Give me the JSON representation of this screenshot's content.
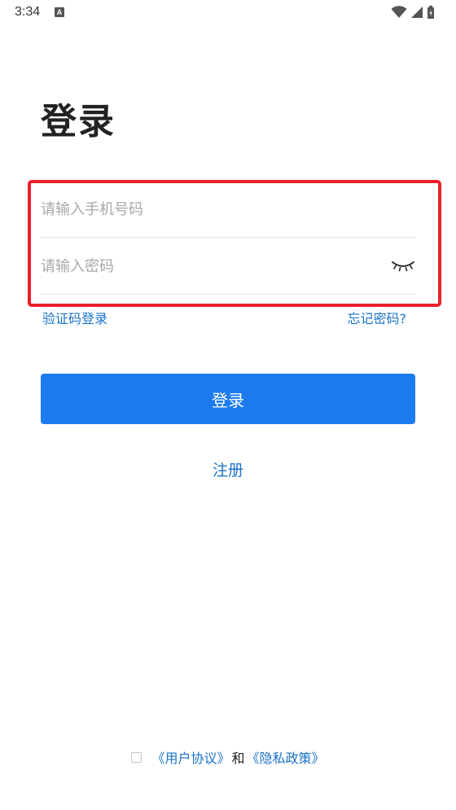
{
  "status_bar": {
    "time": "3:34",
    "notification_icon_label": "A",
    "icons": [
      "wifi-icon",
      "signal-icon",
      "battery-icon"
    ]
  },
  "page": {
    "title": "登录"
  },
  "form": {
    "phone_placeholder": "请输入手机号码",
    "phone_value": "",
    "password_placeholder": "请输入密码",
    "password_value": "",
    "password_visibility_icon": "eye-closed-icon"
  },
  "links": {
    "sms_login": "验证码登录",
    "forgot_password": "忘记密码?"
  },
  "actions": {
    "login_button": "登录",
    "register_link": "注册"
  },
  "agreement": {
    "checked": false,
    "user_agreement": "《用户协议》",
    "and_text": "和",
    "privacy_policy": "《隐私政策》"
  },
  "colors": {
    "accent": "#1e7bef",
    "link": "#1a73c9",
    "highlight": "#e8202a",
    "placeholder": "#a8a8a8"
  }
}
